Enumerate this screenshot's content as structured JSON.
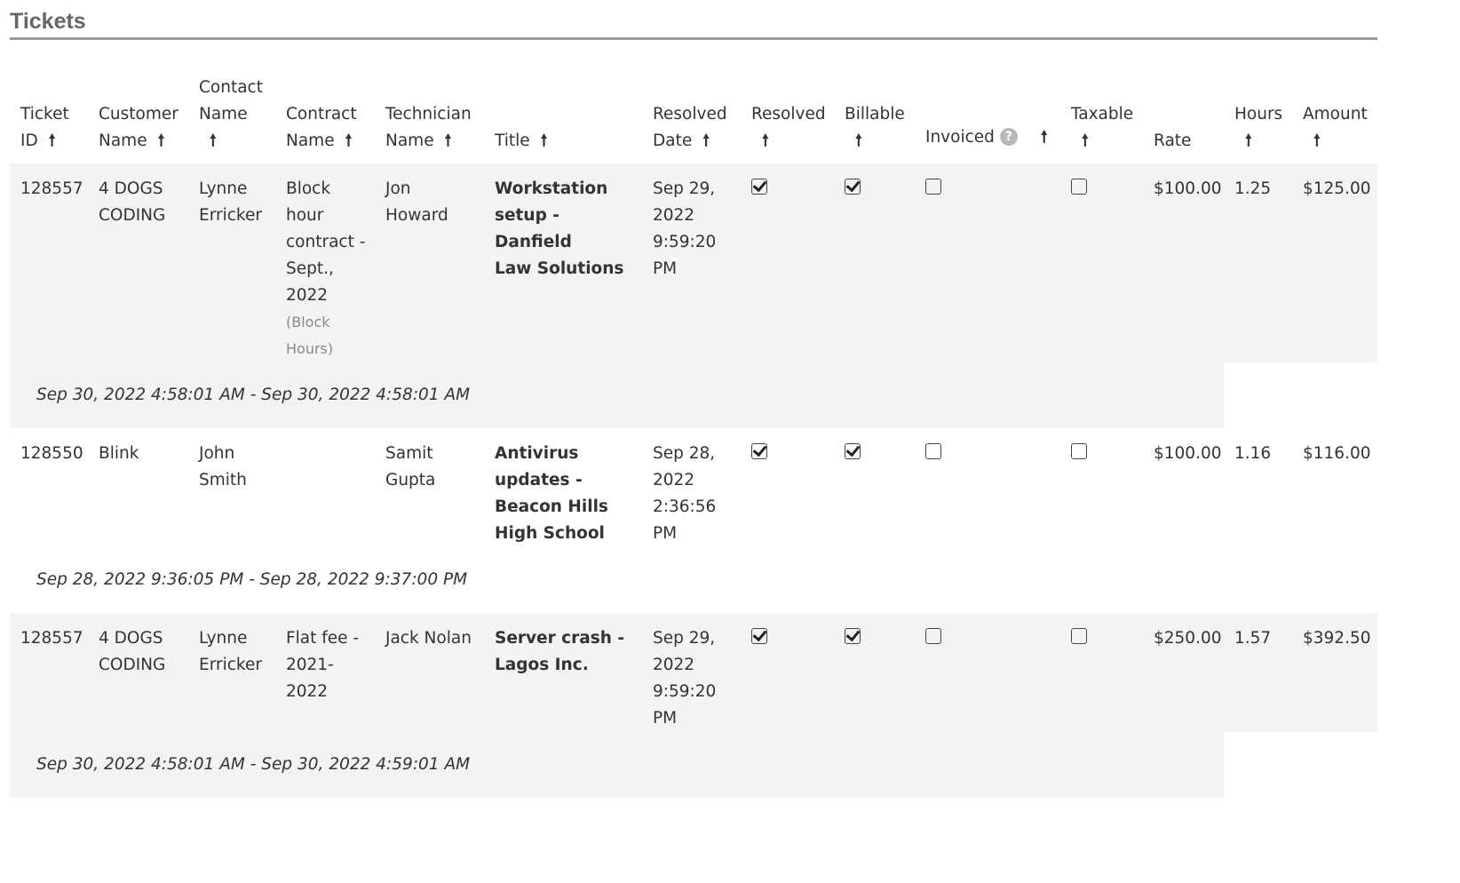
{
  "section": {
    "title": "Tickets"
  },
  "columns": {
    "ticket_id": [
      "Ticket",
      "ID"
    ],
    "customer_name": [
      "Customer",
      "Name"
    ],
    "contact_name": [
      "Contact",
      "Name"
    ],
    "contract_name": [
      "Contract",
      "Name"
    ],
    "technician_name": [
      "Technician",
      "Name"
    ],
    "title": "Title",
    "resolved_date": [
      "Resolved",
      "Date"
    ],
    "resolved": "Resolved",
    "billable": "Billable",
    "invoiced": "Invoiced",
    "taxable": "Taxable",
    "rate": "Rate",
    "hours": "Hours",
    "amount": "Amount",
    "sort_arrow": "🠕",
    "help_glyph": "?"
  },
  "icons": {
    "sort": "sort-ascending-icon",
    "help": "help-icon",
    "checked": "checkbox-checked-icon",
    "unchecked": "checkbox-unchecked-icon"
  },
  "rows": [
    {
      "ticket_id": "128557",
      "customer_name": [
        "4 DOGS",
        "CODING"
      ],
      "contact_name": [
        "Lynne",
        "Erricker"
      ],
      "contract_name": [
        "Block",
        "hour",
        "contract -",
        "Sept.,",
        "2022"
      ],
      "contract_note": [
        "(Block",
        "Hours)"
      ],
      "technician_name": [
        "Jon",
        "Howard"
      ],
      "title": [
        "Workstation",
        "setup - Danfield",
        "Law Solutions"
      ],
      "resolved_date": [
        "Sep 29,",
        "2022",
        "9:59:20",
        "PM"
      ],
      "resolved": true,
      "billable": true,
      "invoiced": false,
      "taxable": false,
      "rate": "$100.00",
      "hours": "1.25",
      "amount": "$125.00",
      "time_range": "Sep 30, 2022 4:58:01 AM - Sep 30, 2022 4:58:01 AM"
    },
    {
      "ticket_id": "128550",
      "customer_name": [
        "Blink"
      ],
      "contact_name": [
        "John",
        "Smith"
      ],
      "contract_name": [],
      "contract_note": [],
      "technician_name": [
        "Samit",
        "Gupta"
      ],
      "title": [
        "Antivirus",
        "updates -",
        "Beacon Hills",
        "High School"
      ],
      "resolved_date": [
        "Sep 28,",
        "2022",
        "2:36:56",
        "PM"
      ],
      "resolved": true,
      "billable": true,
      "invoiced": false,
      "taxable": false,
      "rate": "$100.00",
      "hours": "1.16",
      "amount": "$116.00",
      "time_range": "Sep 28, 2022 9:36:05 PM - Sep 28, 2022 9:37:00 PM"
    },
    {
      "ticket_id": "128557",
      "customer_name": [
        "4 DOGS",
        "CODING"
      ],
      "contact_name": [
        "Lynne",
        "Erricker"
      ],
      "contract_name": [
        "Flat fee -",
        "2021-",
        "2022"
      ],
      "contract_note": [],
      "technician_name": [
        "Jack Nolan"
      ],
      "title": [
        "Server crash -",
        "Lagos Inc."
      ],
      "resolved_date": [
        "Sep 29,",
        "2022",
        "9:59:20",
        "PM"
      ],
      "resolved": true,
      "billable": true,
      "invoiced": false,
      "taxable": false,
      "rate": "$250.00",
      "hours": "1.57",
      "amount": "$392.50",
      "time_range": "Sep 30, 2022 4:58:01 AM - Sep 30, 2022 4:59:01 AM"
    }
  ]
}
